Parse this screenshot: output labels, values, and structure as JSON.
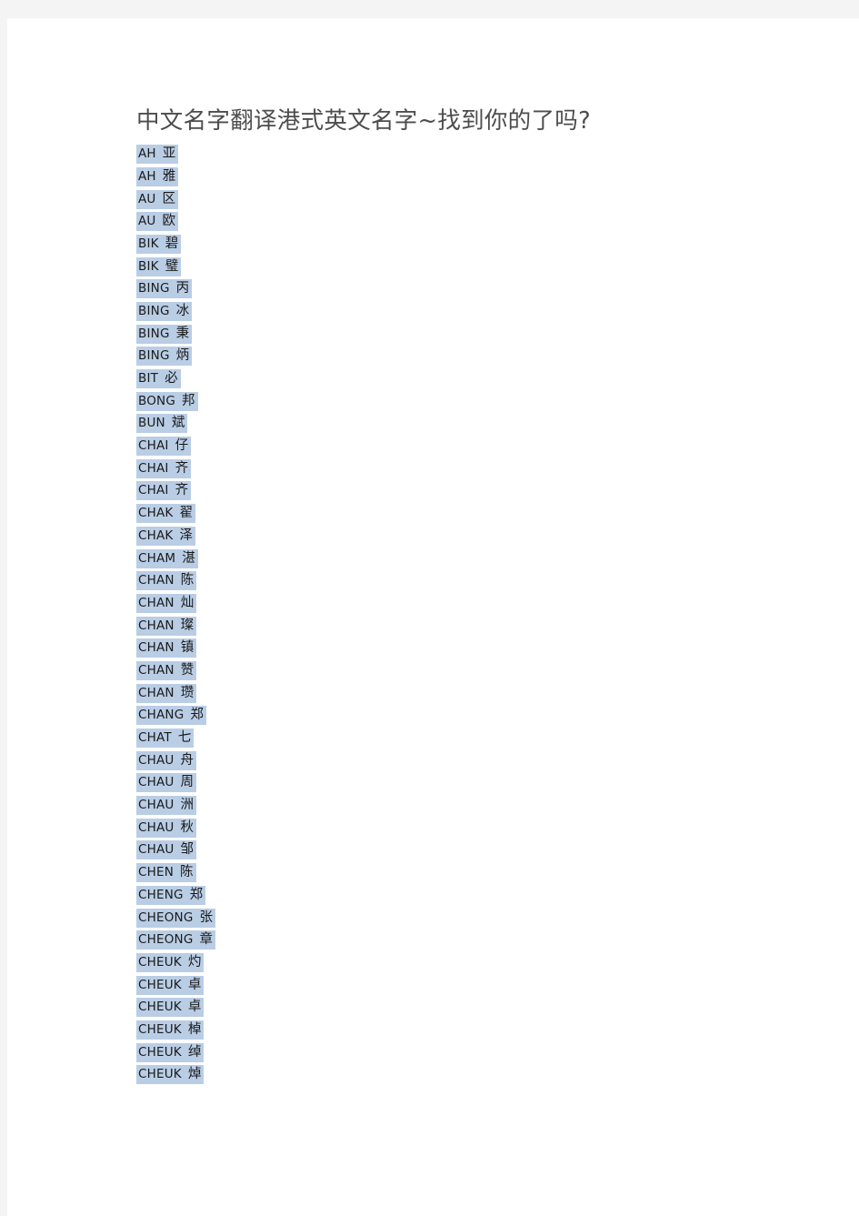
{
  "document": {
    "title": "中文名字翻译港式英文名字~找到你的了吗?",
    "highlight_color": "#b9cde5",
    "title_color": "#4d4d4d",
    "page_background": "#ffffff",
    "canvas_background": "#f4f4f4"
  },
  "name_list": [
    {
      "roman": "AH",
      "hanzi": "亚"
    },
    {
      "roman": "AH",
      "hanzi": "雅"
    },
    {
      "roman": "AU",
      "hanzi": "区"
    },
    {
      "roman": "AU",
      "hanzi": "欧"
    },
    {
      "roman": "BIK",
      "hanzi": "碧"
    },
    {
      "roman": "BIK",
      "hanzi": "璧"
    },
    {
      "roman": "BING",
      "hanzi": "丙"
    },
    {
      "roman": "BING",
      "hanzi": "冰"
    },
    {
      "roman": "BING",
      "hanzi": "秉"
    },
    {
      "roman": "BING",
      "hanzi": "炳"
    },
    {
      "roman": "BIT",
      "hanzi": "必"
    },
    {
      "roman": "BONG",
      "hanzi": "邦"
    },
    {
      "roman": "BUN",
      "hanzi": "斌"
    },
    {
      "roman": "CHAI",
      "hanzi": "仔"
    },
    {
      "roman": "CHAI",
      "hanzi": "齐"
    },
    {
      "roman": "CHAI",
      "hanzi": "齐"
    },
    {
      "roman": "CHAK",
      "hanzi": "翟"
    },
    {
      "roman": "CHAK",
      "hanzi": "泽"
    },
    {
      "roman": "CHAM",
      "hanzi": "湛"
    },
    {
      "roman": "CHAN",
      "hanzi": "陈"
    },
    {
      "roman": "CHAN",
      "hanzi": "灿"
    },
    {
      "roman": "CHAN",
      "hanzi": "璨"
    },
    {
      "roman": "CHAN",
      "hanzi": "镇"
    },
    {
      "roman": "CHAN",
      "hanzi": "赞"
    },
    {
      "roman": "CHAN",
      "hanzi": "瓒"
    },
    {
      "roman": "CHANG",
      "hanzi": "郑"
    },
    {
      "roman": "CHAT",
      "hanzi": "七"
    },
    {
      "roman": "CHAU",
      "hanzi": "舟"
    },
    {
      "roman": "CHAU",
      "hanzi": "周"
    },
    {
      "roman": "CHAU",
      "hanzi": "洲"
    },
    {
      "roman": "CHAU",
      "hanzi": "秋"
    },
    {
      "roman": "CHAU",
      "hanzi": "邹"
    },
    {
      "roman": "CHEN",
      "hanzi": "陈"
    },
    {
      "roman": "CHENG",
      "hanzi": "郑"
    },
    {
      "roman": "CHEONG",
      "hanzi": "张"
    },
    {
      "roman": "CHEONG",
      "hanzi": "章"
    },
    {
      "roman": "CHEUK",
      "hanzi": "灼"
    },
    {
      "roman": "CHEUK",
      "hanzi": "卓"
    },
    {
      "roman": "CHEUK",
      "hanzi": "卓"
    },
    {
      "roman": "CHEUK",
      "hanzi": "棹"
    },
    {
      "roman": "CHEUK",
      "hanzi": "绰"
    },
    {
      "roman": "CHEUK",
      "hanzi": "焯"
    }
  ]
}
